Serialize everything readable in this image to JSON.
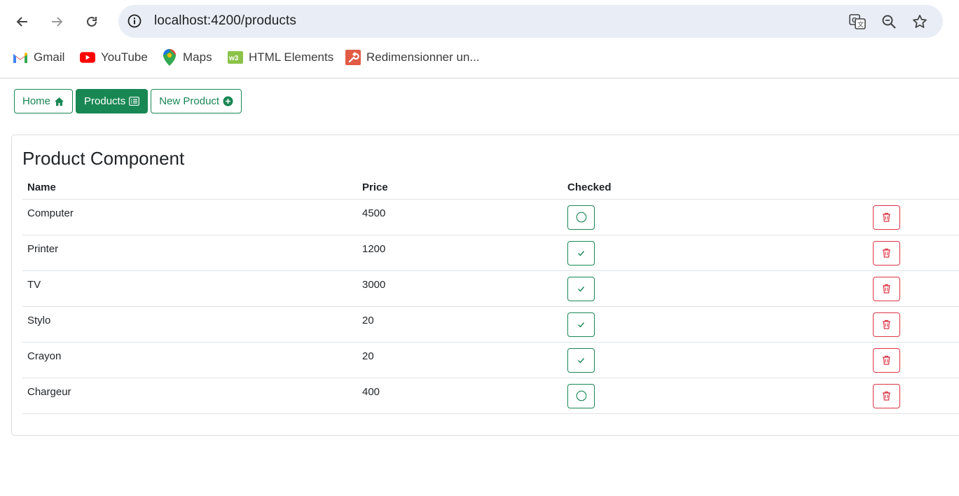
{
  "browser": {
    "url": "localhost:4200/products",
    "bookmarks": [
      {
        "label": "Gmail",
        "icon": "gmail-icon"
      },
      {
        "label": "YouTube",
        "icon": "youtube-icon"
      },
      {
        "label": "Maps",
        "icon": "maps-icon"
      },
      {
        "label": "HTML Elements",
        "icon": "w3-icon"
      },
      {
        "label": "Redimensionner un...",
        "icon": "wrench-icon"
      }
    ]
  },
  "nav": {
    "home": "Home",
    "products": "Products",
    "new_product": "New Product"
  },
  "card": {
    "title": "Product Component"
  },
  "table": {
    "headers": {
      "name": "Name",
      "price": "Price",
      "checked": "Checked"
    },
    "rows": [
      {
        "name": "Computer",
        "price": "4500",
        "checked": false
      },
      {
        "name": "Printer",
        "price": "1200",
        "checked": true
      },
      {
        "name": "TV",
        "price": "3000",
        "checked": true
      },
      {
        "name": "Stylo",
        "price": "20",
        "checked": true
      },
      {
        "name": "Crayon",
        "price": "20",
        "checked": true
      },
      {
        "name": "Chargeur",
        "price": "400",
        "checked": false
      }
    ]
  },
  "colors": {
    "success": "#198754",
    "danger": "#dc3545"
  }
}
